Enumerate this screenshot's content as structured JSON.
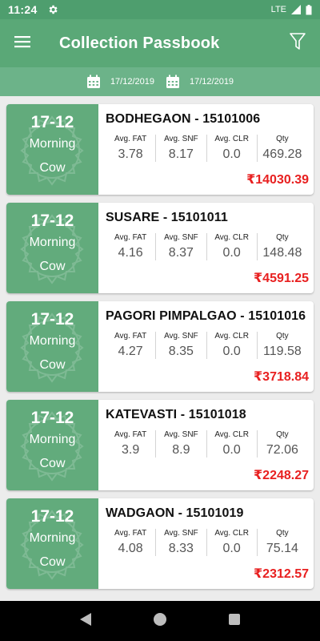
{
  "status_bar": {
    "time": "11:24",
    "network": "LTE"
  },
  "app_bar": {
    "title": "Collection Passbook"
  },
  "date_range": {
    "from": "17/12/2019",
    "to": "17/12/2019"
  },
  "metric_labels": {
    "fat": "Avg. FAT",
    "snf": "Avg. SNF",
    "clr": "Avg. CLR",
    "qty": "Qty"
  },
  "entries": [
    {
      "date": "17-12",
      "shift": "Morning",
      "type": "Cow",
      "center": "BODHEGAON - 15101006",
      "fat": "3.78",
      "snf": "8.17",
      "clr": "0.0",
      "qty": "469.28",
      "amount": "₹14030.39"
    },
    {
      "date": "17-12",
      "shift": "Morning",
      "type": "Cow",
      "center": "SUSARE - 15101011",
      "fat": "4.16",
      "snf": "8.37",
      "clr": "0.0",
      "qty": "148.48",
      "amount": "₹4591.25"
    },
    {
      "date": "17-12",
      "shift": "Morning",
      "type": "Cow",
      "center": "PAGORI PIMPALGAO - 15101016",
      "fat": "4.27",
      "snf": "8.35",
      "clr": "0.0",
      "qty": "119.58",
      "amount": "₹3718.84"
    },
    {
      "date": "17-12",
      "shift": "Morning",
      "type": "Cow",
      "center": "KATEVASTI - 15101018",
      "fat": "3.9",
      "snf": "8.9",
      "clr": "0.0",
      "qty": "72.06",
      "amount": "₹2248.27"
    },
    {
      "date": "17-12",
      "shift": "Morning",
      "type": "Cow",
      "center": "WADGAON - 15101019",
      "fat": "4.08",
      "snf": "8.33",
      "clr": "0.0",
      "qty": "75.14",
      "amount": "₹2312.57"
    }
  ],
  "colors": {
    "primary": "#5aa877",
    "status_bar": "#4e9e6e",
    "date_bar": "#6cb389",
    "card_left": "#62ab7c",
    "amount": "#e82020"
  },
  "icons": {
    "menu": "hamburger-icon",
    "filter": "filter-icon",
    "calendar": "calendar-icon",
    "settings": "gear-icon",
    "back": "back-triangle-icon",
    "home": "home-circle-icon",
    "recents": "recents-square-icon"
  }
}
